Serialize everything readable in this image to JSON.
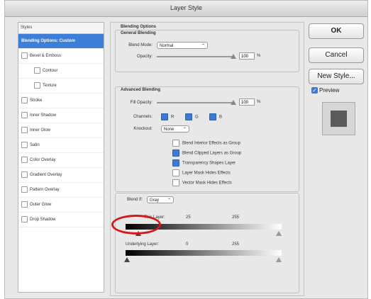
{
  "window": {
    "title": "Layer Style"
  },
  "styles_panel": {
    "header": "Styles",
    "items": [
      {
        "label": "Blending Options: Custom",
        "selected": true,
        "checkbox": false,
        "indent": false
      },
      {
        "label": "Bevel & Emboss",
        "selected": false,
        "checkbox": true,
        "indent": false
      },
      {
        "label": "Contour",
        "selected": false,
        "checkbox": true,
        "indent": true
      },
      {
        "label": "Texture",
        "selected": false,
        "checkbox": true,
        "indent": true
      },
      {
        "label": "Stroke",
        "selected": false,
        "checkbox": true,
        "indent": false
      },
      {
        "label": "Inner Shadow",
        "selected": false,
        "checkbox": true,
        "indent": false
      },
      {
        "label": "Inner Glow",
        "selected": false,
        "checkbox": true,
        "indent": false
      },
      {
        "label": "Satin",
        "selected": false,
        "checkbox": true,
        "indent": false
      },
      {
        "label": "Color Overlay",
        "selected": false,
        "checkbox": true,
        "indent": false
      },
      {
        "label": "Gradient Overlay",
        "selected": false,
        "checkbox": true,
        "indent": false
      },
      {
        "label": "Pattern Overlay",
        "selected": false,
        "checkbox": true,
        "indent": false
      },
      {
        "label": "Outer Glow",
        "selected": false,
        "checkbox": true,
        "indent": false
      },
      {
        "label": "Drop Shadow",
        "selected": false,
        "checkbox": true,
        "indent": false
      }
    ]
  },
  "buttons": {
    "ok": "OK",
    "cancel": "Cancel",
    "new_style": "New Style...",
    "preview": "Preview"
  },
  "blending": {
    "section_title": "Blending Options",
    "general_title": "General Blending",
    "blend_mode_label": "Blend Mode:",
    "blend_mode_value": "Normal",
    "opacity_label": "Opacity:",
    "opacity_value": "100",
    "advanced_title": "Advanced Blending",
    "fill_opacity_label": "Fill Opacity:",
    "fill_opacity_value": "100",
    "percent": "%",
    "channels_label": "Channels:",
    "channel_r": "R",
    "channel_g": "G",
    "channel_b": "B",
    "knockout_label": "Knockout:",
    "knockout_value": "None",
    "options": [
      {
        "label": "Blend Interior Effects as Group",
        "checked": false
      },
      {
        "label": "Blend Clipped Layers as Group",
        "checked": true
      },
      {
        "label": "Transparency Shapes Layer",
        "checked": true
      },
      {
        "label": "Layer Mask Hides Effects",
        "checked": false
      },
      {
        "label": "Vector Mask Hides Effects",
        "checked": false
      }
    ],
    "blend_if_label": "Blend If:",
    "blend_if_value": "Gray",
    "this_layer_label": "This Layer:",
    "this_layer_low": "25",
    "this_layer_high": "255",
    "underlying_label": "Underlying Layer:",
    "underlying_low": "0",
    "underlying_high": "255"
  },
  "colors": {
    "accent": "#3d7fd8",
    "highlight_ring": "#d21a1a"
  }
}
